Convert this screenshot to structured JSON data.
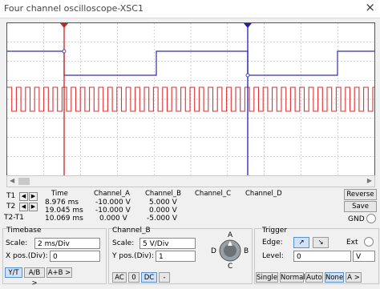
{
  "window": {
    "title": "Four channel oscilloscope-XSC1",
    "close": "×"
  },
  "readout": {
    "headers": [
      "Time",
      "Channel_A",
      "Channel_B",
      "Channel_C",
      "Channel_D"
    ],
    "rows": [
      {
        "label": "T1",
        "time": "8.976 ms",
        "a": "-10.000 V",
        "b": "5.000 V",
        "c": "",
        "d": ""
      },
      {
        "label": "T2",
        "time": "19.045 ms",
        "a": "-10.000 V",
        "b": "0.000 V",
        "c": "",
        "d": ""
      },
      {
        "label": "T2-T1",
        "time": "10.069 ms",
        "a": "0.000 V",
        "b": "-5.000 V",
        "c": "",
        "d": ""
      }
    ],
    "reverse": "Reverse",
    "save": "Save",
    "gnd": "GND"
  },
  "timebase": {
    "title": "Timebase",
    "scale_label": "Scale:",
    "scale_value": "2 ms/Div",
    "xpos_label": "X pos.(Div):",
    "xpos_value": "0",
    "modes": [
      "Y/T",
      "A/B >",
      "A+B >"
    ]
  },
  "channel": {
    "title": "Channel_B",
    "scale_label": "Scale:",
    "scale_value": "5  V/Div",
    "ypos_label": "Y pos.(Div):",
    "ypos_value": "1",
    "coupling": [
      "AC",
      "0",
      "DC",
      "-"
    ],
    "knob_letters": {
      "a": "A",
      "b": "B",
      "c": "C",
      "d": "D"
    }
  },
  "trigger": {
    "title": "Trigger",
    "edge_label": "Edge:",
    "ext_label": "Ext",
    "level_label": "Level:",
    "level_value": "0",
    "level_unit": "V",
    "modes": [
      "Single",
      "Normal",
      "Auto",
      "None",
      "A >"
    ]
  },
  "colors": {
    "channel_a": "#e03030",
    "channel_b": "#3030a0",
    "cursor1": "#d02020",
    "cursor2": "#2020b0",
    "grid": "#9a9a9a"
  }
}
